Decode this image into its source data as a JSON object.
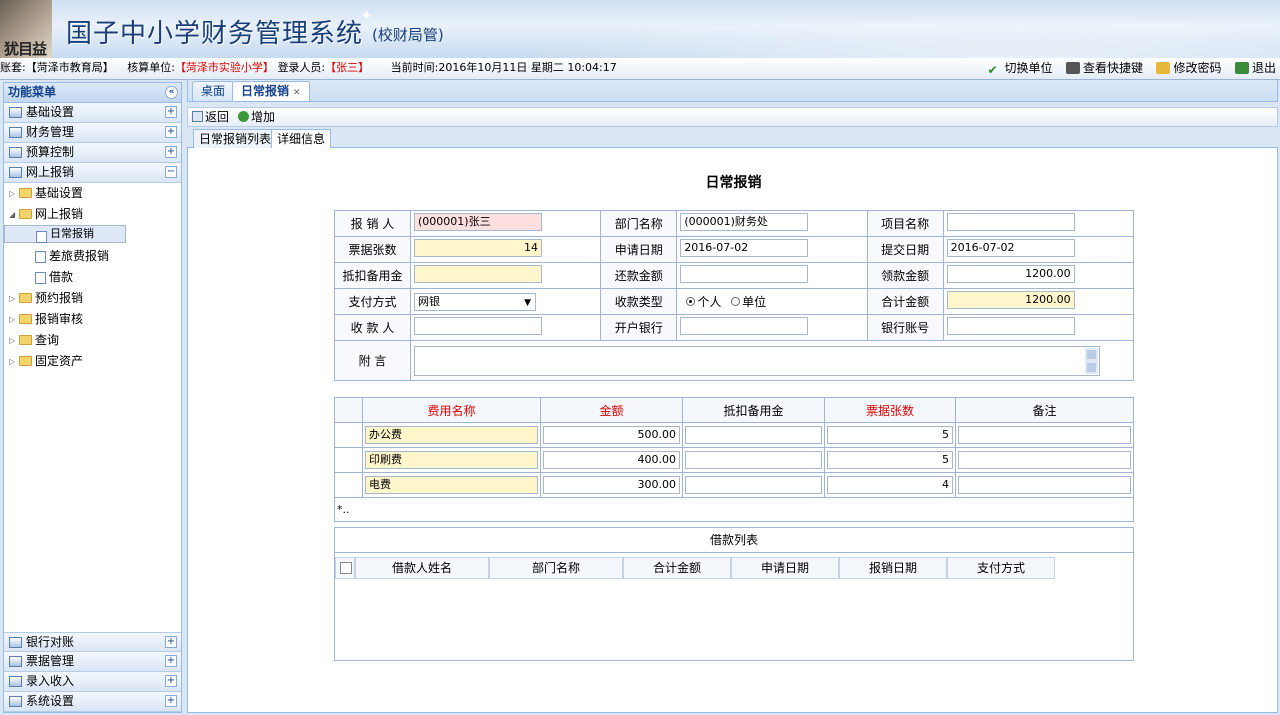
{
  "header": {
    "title": "国子中小学财务管理系统",
    "subtitle": "(校财局管)",
    "logo_text": "犹目益"
  },
  "infobar": {
    "account_label": "账套:",
    "account_value": "【菏泽市教育局】",
    "unit_label": "核算单位:",
    "unit_value": "【菏泽市实验小学】",
    "user_label": "登录人员:",
    "user_value": "【张三】",
    "time_label": "当前时间:",
    "time_value": "2016年10月11日 星期二 10:04:17",
    "tools": [
      "切换单位",
      "查看快捷键",
      "修改密码",
      "退出"
    ]
  },
  "sidebar": {
    "title": "功能菜单",
    "top_sections": [
      "基础设置",
      "财务管理",
      "预算控制",
      "网上报销"
    ],
    "tree": [
      {
        "label": "基础设置",
        "kind": "folder",
        "level": 1
      },
      {
        "label": "网上报销",
        "kind": "folder",
        "level": 1,
        "open": true
      },
      {
        "label": "日常报销",
        "kind": "doc",
        "level": 2,
        "selected": true
      },
      {
        "label": "差旅费报销",
        "kind": "doc",
        "level": 2
      },
      {
        "label": "借款",
        "kind": "doc",
        "level": 2
      },
      {
        "label": "预约报销",
        "kind": "folder",
        "level": 1
      },
      {
        "label": "报销审核",
        "kind": "folder",
        "level": 1
      },
      {
        "label": "查询",
        "kind": "folder",
        "level": 1
      },
      {
        "label": "固定资产",
        "kind": "folder",
        "level": 1
      }
    ],
    "bottom_sections": [
      "银行对账",
      "票据管理",
      "录入收入",
      "系统设置"
    ]
  },
  "tabs": [
    "桌面",
    "日常报销"
  ],
  "toolbar": {
    "back": "返回",
    "add": "增加"
  },
  "subtabs": [
    "日常报销列表",
    "详细信息"
  ],
  "form": {
    "title": "日常报销",
    "labels": {
      "claimant": "报 销 人",
      "dept": "部门名称",
      "project": "项目名称",
      "receipts": "票据张数",
      "apply_date": "申请日期",
      "submit_date": "提交日期",
      "offset": "抵扣备用金",
      "repay": "还款金额",
      "receive": "领款金额",
      "pay_method": "支付方式",
      "payee_type": "收款类型",
      "total": "合计金额",
      "payee": "收 款 人",
      "bank": "开户银行",
      "account": "银行账号",
      "note": "附 言"
    },
    "values": {
      "claimant": "(000001)张三",
      "dept": "(000001)财务处",
      "project": "",
      "receipts": "14",
      "apply_date": "2016-07-02",
      "submit_date": "2016-07-02",
      "offset": "",
      "repay": "",
      "receive": "1200.00",
      "pay_method": "网银",
      "payee_type_options": [
        "个人",
        "单位"
      ],
      "total": "1200.00",
      "payee": "",
      "bank": "",
      "account": ""
    }
  },
  "expenses": {
    "headers": [
      "费用名称",
      "金额",
      "抵扣备用金",
      "票据张数",
      "备注"
    ],
    "rows": [
      {
        "name": "办公费",
        "amount": "500.00",
        "offset": "",
        "receipts": "5",
        "note": ""
      },
      {
        "name": "印刷费",
        "amount": "400.00",
        "offset": "",
        "receipts": "5",
        "note": ""
      },
      {
        "name": "电费",
        "amount": "300.00",
        "offset": "",
        "receipts": "4",
        "note": ""
      }
    ],
    "footer": "*.."
  },
  "loans": {
    "title": "借款列表",
    "headers": [
      "借款人姓名",
      "部门名称",
      "合计金额",
      "申请日期",
      "报销日期",
      "支付方式"
    ]
  }
}
